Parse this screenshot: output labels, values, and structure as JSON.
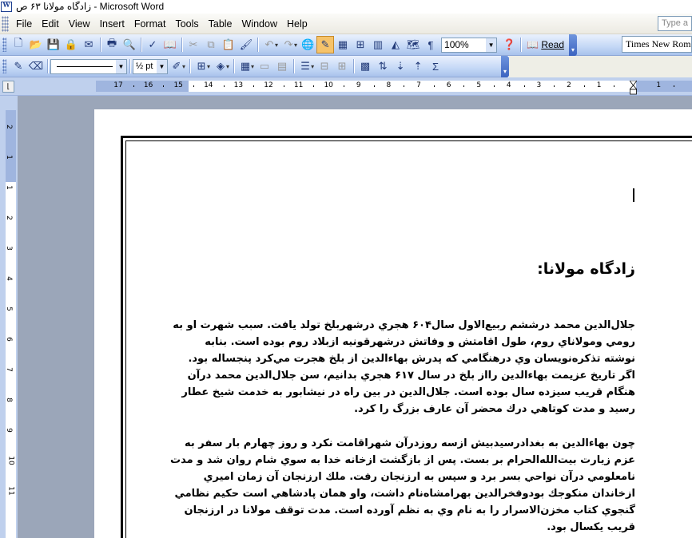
{
  "window": {
    "title": "زادگاه مولانا ۶۳ ص - Microsoft Word"
  },
  "menubar": {
    "items": [
      "File",
      "Edit",
      "View",
      "Insert",
      "Format",
      "Tools",
      "Table",
      "Window",
      "Help"
    ],
    "help_placeholder": "Type a"
  },
  "toolbar_standard": {
    "zoom": "100%",
    "read_label": "Read",
    "font_name": "Times New Roman"
  },
  "toolbar_tables": {
    "line_weight": "½ pt"
  },
  "ruler": {
    "numbers": [
      "17",
      "16",
      "15",
      "14",
      "13",
      "12",
      "11",
      "10",
      "9",
      "8",
      "7",
      "6",
      "5",
      "4",
      "3",
      "2",
      "1",
      "1"
    ],
    "vertical_numbers": [
      "2",
      "1",
      "1",
      "2",
      "3",
      "4",
      "5",
      "6",
      "7",
      "8",
      "9",
      "10",
      "11"
    ]
  },
  "document": {
    "heading": "زادگاه مولانا:",
    "paragraph1": [
      "جلال‌الدين محمد درششم ربيع‌الاول سال۶۰۴ هجري درشهربلخ تولد يافت. سبب شهرت او به",
      "رومي ومولاناي روم، طول اقامتش و وفاتش درشهرقونيه ازبلاد روم بوده است. بنابه",
      "نوشته تذكره‌نويسان وي درهنگامي كه پدرش بهاءالدين از بلخ هجرت مي‌كرد پنجساله بود.",
      "اگر تاريخ عزيمت بهاءالدين رااز بلخ  در سال ۶۱۷ هجري بدانيم، سن جلال‌الدين محمد درآن",
      "هنگام قريب سيزده سال بوده است. جلال‌الدين در بين راه در نيشابور به خدمت شيخ عطار",
      "رسيد و مدت كوتاهي درك محضر آن عارف بزرگ را كرد."
    ],
    "paragraph2": [
      "چون بهاءالدين به بغدادرسيدبيش ازسه روزدرآن شهراقامت نكرد و روز چهارم بار سفر به",
      "عزم زيارت بيت‌الله‌الحرام بر بست. پس از بازگشت ازخانه خدا به سوي شام روان شد و مدت",
      "نامعلومي درآن نواحي بسر برد و سپس به   ارزنجان  رفت. ملك ارزنجان آن زمان اميري",
      "ازخاندان منكوجك بودوفخرالدين بهرامشاه‌نام داشت، واو همان پادشاهي است حكيم نظامي",
      "گنجوي كتاب مخزن‌الاسرار را به نام وي به نظم آورده است. مدت توقف مولانا در ارزنجان",
      "قريب يكسال بود."
    ]
  }
}
